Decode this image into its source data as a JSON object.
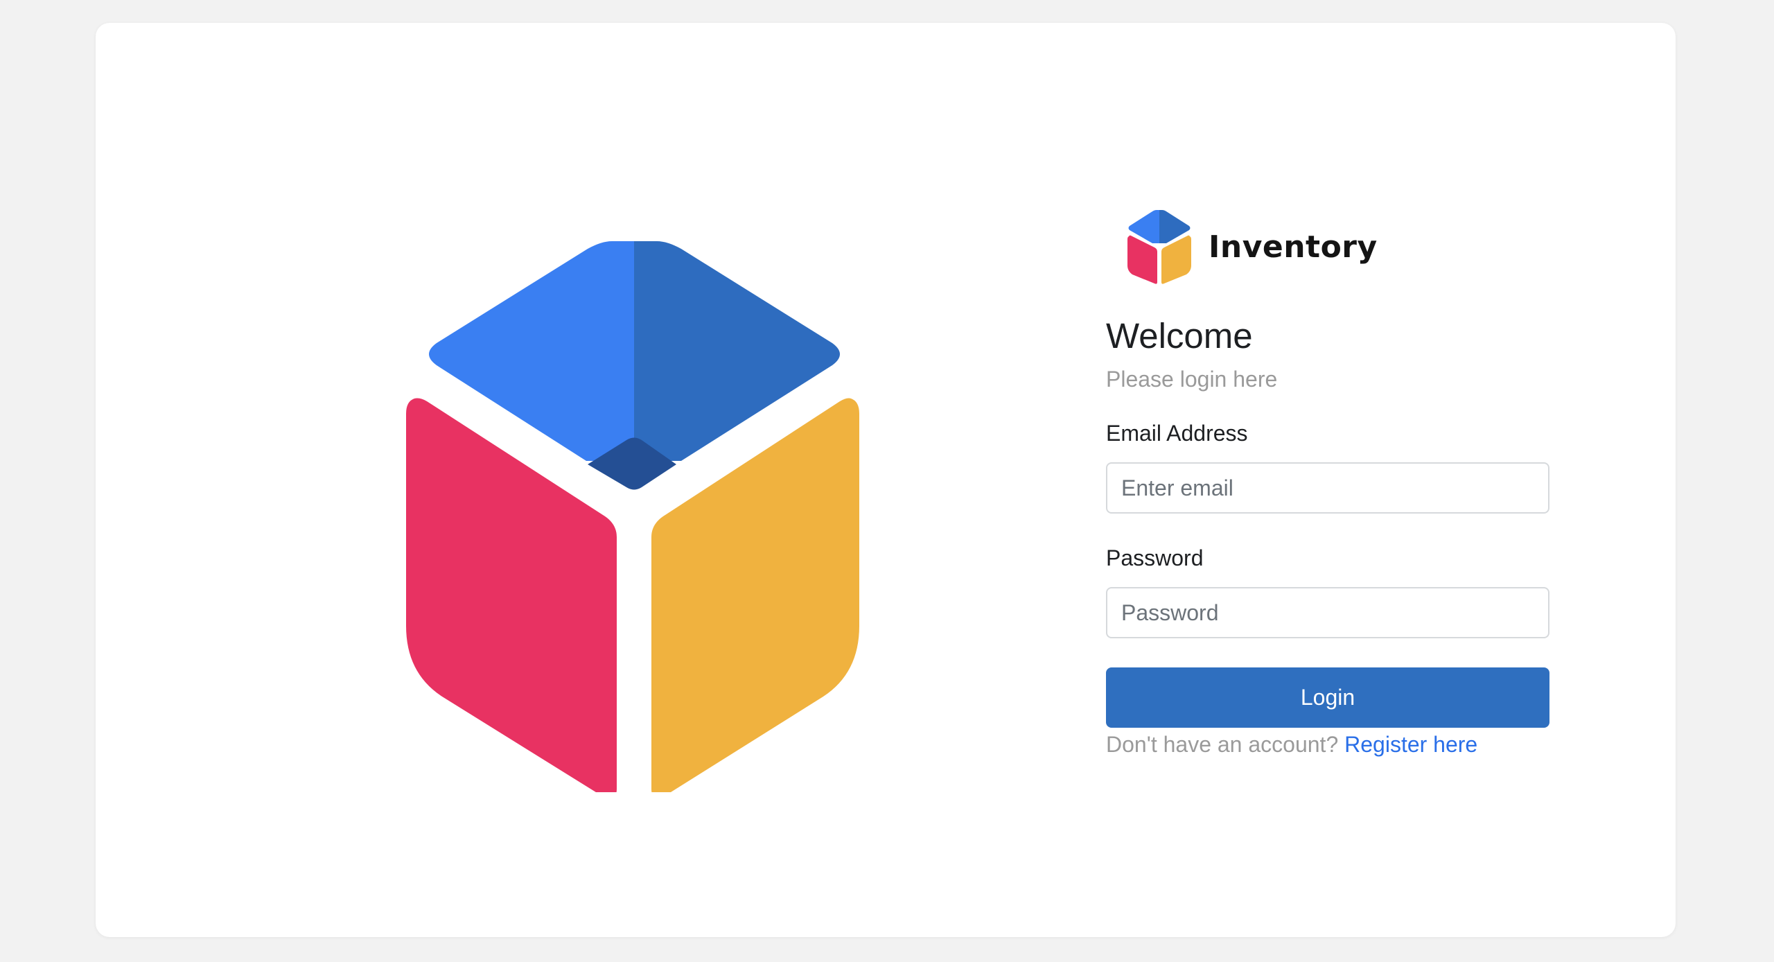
{
  "brand": {
    "name": "Inventory"
  },
  "login": {
    "heading": "Welcome",
    "subtitle": "Please login here",
    "email_label": "Email Address",
    "email_placeholder": "Enter email",
    "email_value": "",
    "password_label": "Password",
    "password_placeholder": "Password",
    "password_value": "",
    "submit_label": "Login",
    "register_prompt": "Don't have an account?",
    "register_link": "Register here"
  },
  "colors": {
    "page_background": "#f2f2f2",
    "card_background": "#ffffff",
    "primary_button": "#2f6fbf",
    "link": "#2a6fe8",
    "logo_blue_light": "#3a7ff2",
    "logo_blue_dark": "#2e6cbf",
    "logo_blue_deep": "#244f94",
    "logo_red": "#e83262",
    "logo_yellow": "#f0b23f"
  },
  "icons": {
    "hero": "cube-logo-icon",
    "brand": "cube-logo-icon"
  }
}
